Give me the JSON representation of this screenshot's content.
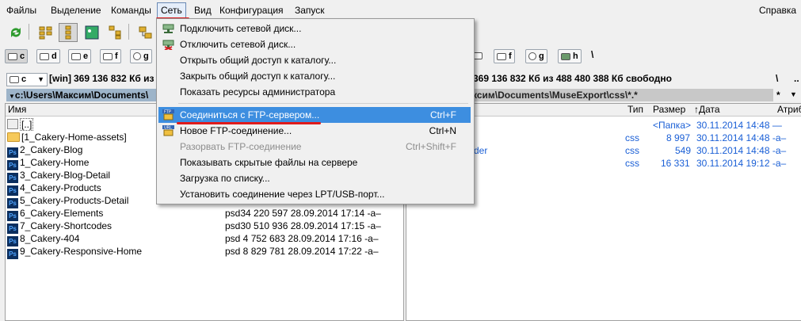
{
  "menubar": {
    "items": [
      "Файлы",
      "Выделение",
      "Команды",
      "Сеть",
      "Вид",
      "Конфигурация",
      "Запуск"
    ],
    "help": "Справка"
  },
  "drives_left": [
    "c",
    "d",
    "e",
    "f",
    "g"
  ],
  "drives_right": [
    "f",
    "g",
    "h"
  ],
  "left_panel": {
    "drive_select": "c",
    "volume": "[win]",
    "free": "369 136 832 Кб из",
    "path": "c:\\Users\\Максим\\Documents\\",
    "col_name": "Имя",
    "rows": [
      {
        "name": "[..]",
        "info": ""
      },
      {
        "name": "[1_Cakery-Home-assets]",
        "info": ""
      },
      {
        "name": "2_Cakery-Blog",
        "info": ""
      },
      {
        "name": "1_Cakery-Home",
        "info": ""
      },
      {
        "name": "3_Cakery-Blog-Detail",
        "info": ""
      },
      {
        "name": "4_Cakery-Products",
        "info": ""
      },
      {
        "name": "5_Cakery-Products-Detail",
        "info": ""
      },
      {
        "name": "6_Cakery-Elements",
        "info": "psd34 220 597 28.09.2014 17:14 -a–"
      },
      {
        "name": "7_Cakery-Shortcodes",
        "info": "psd30 510 936 28.09.2014 17:15 -a–"
      },
      {
        "name": "8_Cakery-404",
        "info": "psd  4 752 683 28.09.2014 17:16 -a–"
      },
      {
        "name": "9_Cakery-Responsive-Home",
        "info": "psd  8 829 781 28.09.2014 17:22 -a–"
      }
    ]
  },
  "right_panel": {
    "free": "369 136 832 Кб из 488 480 388 Кб свободно",
    "path": "ксим\\Documents\\MuseExport\\css\\*.*",
    "cols": {
      "type": "Тип",
      "size": "Размер",
      "date": "↑Дата",
      "attr": "Атриб"
    },
    "rows": [
      {
        "type": "",
        "size": "<Папка>",
        "date": "30.11.2014 14:48 —"
      },
      {
        "type": "css",
        "size": "8 997",
        "date": "30.11.2014 14:48 -a–"
      },
      {
        "type": "css",
        "size": "549",
        "date": "30.11.2014 14:48 -a–"
      },
      {
        "type": "css",
        "size": "16 331",
        "date": "30.11.2014 19:12 -a–"
      }
    ],
    "partial_name": "der",
    "tool_backslash": "\\",
    "tool_dots": "..",
    "filter": "*"
  },
  "dropdown": {
    "items": [
      {
        "label": "Подключить сетевой диск...",
        "shortcut": "",
        "icon": "network-drive-connect-icon",
        "disabled": false,
        "highlight": false
      },
      {
        "label": "Отключить сетевой диск...",
        "shortcut": "",
        "icon": "network-drive-disconnect-icon",
        "disabled": false,
        "highlight": false
      },
      {
        "label": "Открыть общий доступ к каталогу...",
        "shortcut": "",
        "icon": "",
        "disabled": false,
        "highlight": false
      },
      {
        "label": "Закрыть общий доступ к каталогу...",
        "shortcut": "",
        "icon": "",
        "disabled": false,
        "highlight": false
      },
      {
        "label": "Показать ресурсы администратора",
        "shortcut": "",
        "icon": "",
        "disabled": false,
        "highlight": false
      },
      {
        "label": "Соединиться с FTP-сервером...",
        "shortcut": "Ctrl+F",
        "icon": "ftp-connect-icon",
        "disabled": false,
        "highlight": true
      },
      {
        "label": "Новое FTP-соединение...",
        "shortcut": "Ctrl+N",
        "icon": "ftp-new-url-icon",
        "disabled": false,
        "highlight": false
      },
      {
        "label": "Разорвать FTP-соединение",
        "shortcut": "Ctrl+Shift+F",
        "icon": "",
        "disabled": true,
        "highlight": false
      },
      {
        "label": "Показывать скрытые файлы на сервере",
        "shortcut": "",
        "icon": "",
        "disabled": false,
        "highlight": false
      },
      {
        "label": "Загрузка по списку...",
        "shortcut": "",
        "icon": "",
        "disabled": false,
        "highlight": false
      },
      {
        "label": "Установить соединение через LPT/USB-порт...",
        "shortcut": "",
        "icon": "",
        "disabled": false,
        "highlight": false
      }
    ]
  },
  "colors": {
    "highlight": "#3d8ee0",
    "annotation": "#e01b1b",
    "path_active": "#9db4c9",
    "link_blue": "#1a5fd6"
  }
}
